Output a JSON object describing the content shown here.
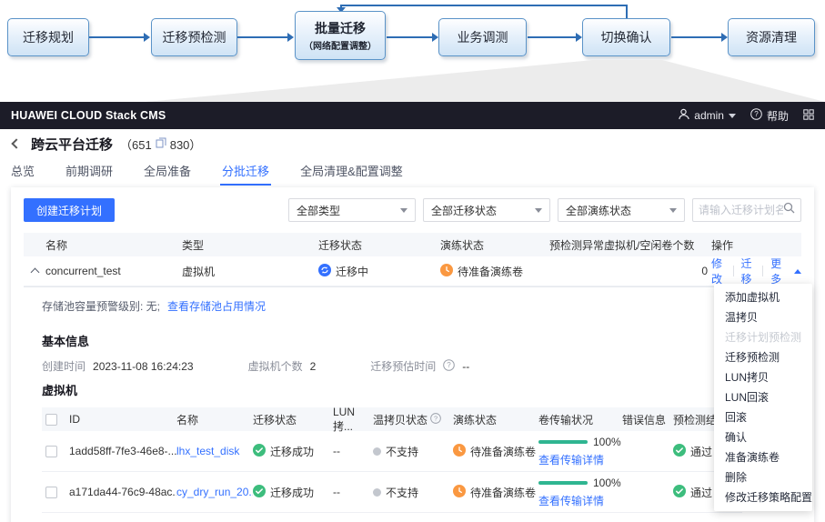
{
  "flow": {
    "steps": [
      {
        "label": "迁移规划"
      },
      {
        "label": "迁移预检测"
      },
      {
        "label": "批量迁移",
        "sub": "（网络配置调整）"
      },
      {
        "label": "业务调测"
      },
      {
        "label": "切换确认"
      },
      {
        "label": "资源清理"
      }
    ]
  },
  "topbar": {
    "brand": "HUAWEI CLOUD Stack CMS",
    "user": "admin",
    "help_label": "帮助"
  },
  "breadcrumb": {
    "title": "跨云平台迁移",
    "count_open": "（651",
    "count_close": "830）"
  },
  "tabs": {
    "items": [
      {
        "label": "总览"
      },
      {
        "label": "前期调研"
      },
      {
        "label": "全局准备"
      },
      {
        "label": "分批迁移"
      },
      {
        "label": "全局清理&配置调整"
      }
    ],
    "active_index": 3
  },
  "toolbar": {
    "create_button": "创建迁移计划",
    "filters": [
      {
        "value": "全部类型"
      },
      {
        "value": "全部迁移状态"
      },
      {
        "value": "全部演练状态"
      }
    ],
    "search_placeholder": "请输入迁移计划名称"
  },
  "plan_table": {
    "headers": [
      "名称",
      "类型",
      "迁移状态",
      "演练状态",
      "预检测异常虚拟机/空闲卷个数",
      "操作"
    ],
    "row": {
      "name": "concurrent_test",
      "type": "虚拟机",
      "migration_status": "迁移中",
      "drill_status": "待准备演练卷",
      "abnormal_count": "0",
      "actions": {
        "modify": "修改",
        "migrate": "迁移",
        "more": "更多"
      }
    }
  },
  "more_menu": {
    "items": [
      {
        "label": "添加虚拟机",
        "disabled": false
      },
      {
        "label": "温拷贝",
        "disabled": false
      },
      {
        "label": "迁移计划预检测",
        "disabled": true
      },
      {
        "label": "迁移预检测",
        "disabled": false
      },
      {
        "label": "LUN拷贝",
        "disabled": false
      },
      {
        "label": "LUN回滚",
        "disabled": false
      },
      {
        "label": "回滚",
        "disabled": false
      },
      {
        "label": "确认",
        "disabled": false
      },
      {
        "label": "准备演练卷",
        "disabled": false
      },
      {
        "label": "删除",
        "disabled": false
      },
      {
        "label": "修改迁移策略配置",
        "disabled": false
      }
    ]
  },
  "detail": {
    "storage_label": "存储池容量预警级别: 无;",
    "storage_link": "查看存储池占用情况",
    "basic_info_title": "基本信息",
    "fields": [
      {
        "label": "创建时间",
        "value": "2023-11-08 16:24:23"
      },
      {
        "label": "虚拟机个数",
        "value": "2"
      },
      {
        "label": "迁移预估时间",
        "value": "--"
      }
    ],
    "vm_section_title": "虚拟机"
  },
  "vm_table": {
    "headers": [
      "ID",
      "名称",
      "迁移状态",
      "LUN拷...",
      "温拷贝状态",
      "演练状态",
      "卷传输状况",
      "错误信息",
      "预检测结果"
    ],
    "rows": [
      {
        "id": "1add58ff-7fe3-46e8-...",
        "name": "lhx_test_disk",
        "migration_status": "迁移成功",
        "lun_copy": "--",
        "warm_copy_status": "不支持",
        "drill_status": "待准备演练卷",
        "transfer_percent": "100%",
        "transfer_link": "查看传输详情",
        "error": "",
        "precheck": "通过"
      },
      {
        "id": "a171da44-76c9-48ac...",
        "name": "cy_dry_run_20...",
        "migration_status": "迁移成功",
        "lun_copy": "--",
        "warm_copy_status": "不支持",
        "drill_status": "待准备演练卷",
        "transfer_percent": "100%",
        "transfer_link": "查看传输详情",
        "error": "",
        "precheck": "通过"
      }
    ]
  },
  "colors": {
    "accent_blue": "#3370ff",
    "success_green": "#3dbd7d",
    "warning_orange": "#fa9841",
    "progress_teal": "#2fb591",
    "header_dark": "#1c1c28"
  },
  "icons": {
    "migrating": "sync-circle",
    "waiting": "clock-circle",
    "success": "check-circle",
    "not_supported": "gray-dot"
  }
}
